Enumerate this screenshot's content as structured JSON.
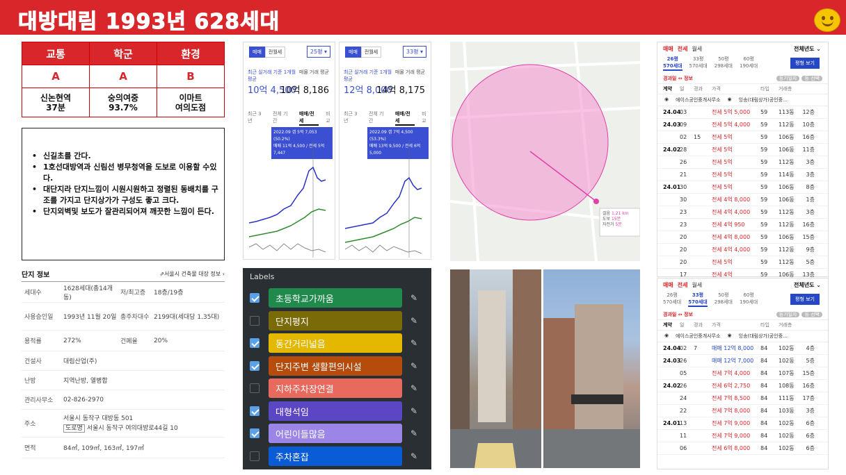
{
  "header": {
    "title": "대방대림 1993년 628세대"
  },
  "ratings": {
    "headers": [
      "교통",
      "학군",
      "환경"
    ],
    "grades": [
      "A",
      "A",
      "B"
    ],
    "details": [
      [
        "신논현역",
        "37분"
      ],
      [
        "숭의여중",
        "93.7%"
      ],
      [
        "이마트",
        "여의도점"
      ]
    ]
  },
  "notes": [
    "신길초를 간다.",
    "1호선대방역과 신림선 병무청역을 도보로 이용할 수있다.",
    "대단지라 단지느낌이 시원시원하고 정렬된 동배치를 구조를 가지고 단지상가가 구성도 좋고 크다.",
    "단지외벽및 보도가 잘관리되어져 깨끗한 느낌이 든다."
  ],
  "complex_info": {
    "title": "단지 정보",
    "link": "서울시 건축물 대장 정보",
    "rows": [
      {
        "k": "세대수",
        "v": "1628세대(총14개동)",
        "k2": "저/최고층",
        "v2": "18층/19층"
      },
      {
        "k": "사용승인일",
        "v": "1993년 11월 20일",
        "k2": "총주차대수",
        "v2": "2199대(세대당 1.35대)"
      },
      {
        "k": "용적률",
        "v": "272%",
        "k2": "건폐율",
        "v2": "20%"
      },
      {
        "k": "건설사",
        "v": "대림산업(주)",
        "k2": "",
        "v2": ""
      },
      {
        "k": "난방",
        "v": "지역난방, 열병합",
        "k2": "",
        "v2": ""
      },
      {
        "k": "관리사무소",
        "v": "02-826-2970",
        "k2": "",
        "v2": ""
      }
    ],
    "address_label": "주소",
    "address": "서울시 동작구 대방동 501",
    "road_tag": "도로명",
    "road_address": "서울시 동작구 여의대방로44길 10",
    "area_label": "면적",
    "area": "84㎡, 109㎡, 163㎡, 197㎡"
  },
  "charts": [
    {
      "tab1": "매매",
      "tab2": "전월세",
      "size": "25평",
      "label1": "최근 실거래 기준 1개월 평균",
      "value1": "10억 4,500",
      "label2": "매물 거래 평균",
      "value2": "10억 8,186",
      "periods": [
        "최근 3년",
        "전체 기간",
        "매매/전세",
        "비교"
      ],
      "tip1": "2022.09 갭 5억 7,053 (50.2%)",
      "tip2": "매매 11억 4,500 / 전세 5억 7,447"
    },
    {
      "tab1": "매매",
      "tab2": "전월세",
      "size": "33평",
      "label1": "최근 실거래 기준 1개월 평균",
      "value1": "12억 8,000",
      "label2": "매물 거래 평균",
      "value2": "14억 8,175",
      "periods": [
        "최근 3년",
        "전체 기간",
        "매매/전세",
        "비교"
      ],
      "tip1": "2022.09 갭 7억 4,500 (53.3%)",
      "tip2": "매매 13억 9,500 / 전세 6억 5,000"
    }
  ],
  "labels": {
    "title": "Labels",
    "items": [
      {
        "text": "초등학교가까움",
        "checked": true,
        "color": "#1f8a4c"
      },
      {
        "text": "단지평지",
        "checked": false,
        "color": "#7a6a08"
      },
      {
        "text": "동간거리넓음",
        "checked": true,
        "color": "#e5b800"
      },
      {
        "text": "단지주변 생활편의시설",
        "checked": true,
        "color": "#b54c0c"
      },
      {
        "text": "지하주차장연결",
        "checked": false,
        "color": "#e8695e"
      },
      {
        "text": "대형석임",
        "checked": true,
        "color": "#5b47c4"
      },
      {
        "text": "어린이들많음",
        "checked": true,
        "color": "#9b86e8"
      },
      {
        "text": "주차혼잡",
        "checked": false,
        "color": "#0a5bd6"
      }
    ]
  },
  "map": {
    "legend": [
      "걸음",
      "도보",
      "자전거"
    ],
    "legend_vals": [
      "1.21 km",
      "15분",
      "5분"
    ]
  },
  "tx1": {
    "tabs": [
      "매매",
      "전세",
      "월세"
    ],
    "year": "전체년도",
    "sizes": [
      [
        "26평",
        "570세대"
      ],
      [
        "33평",
        "570세대"
      ],
      [
        "50평",
        "298세대"
      ],
      [
        "60평",
        "190세대"
      ]
    ],
    "active_size": 0,
    "button": "평형 보기",
    "sub_left": "경과일 ↔ 정보",
    "sub_right": [
      "등기일자",
      "등 선택"
    ],
    "head": [
      "계약",
      "일",
      "경과",
      "가격",
      "타입",
      "거래층"
    ],
    "agents": [
      "에이스공인중개사무소",
      "잉송(대림상가)공인중…"
    ],
    "rows": [
      [
        "24.04",
        "03",
        "",
        "전세 5억 5,000",
        "59",
        "113동",
        "12층"
      ],
      [
        "24.03",
        "09",
        "",
        "전세 5억 4,000",
        "59",
        "112동",
        "10층"
      ],
      [
        "",
        "02",
        "15",
        "전세 5억",
        "59",
        "106동",
        "16층"
      ],
      [
        "24.02",
        "28",
        "",
        "전세 5억",
        "59",
        "106동",
        "11층"
      ],
      [
        "",
        "26",
        "",
        "전세 5억",
        "59",
        "112동",
        "3층"
      ],
      [
        "",
        "21",
        "",
        "전세 5억",
        "59",
        "114동",
        "3층"
      ],
      [
        "24.01",
        "30",
        "",
        "전세 5억",
        "59",
        "106동",
        "8층"
      ],
      [
        "",
        "30",
        "",
        "전세 4억 8,000",
        "59",
        "106동",
        "1층"
      ],
      [
        "",
        "23",
        "",
        "전세 4억 4,000",
        "59",
        "112동",
        "3층"
      ],
      [
        "",
        "23",
        "",
        "전세 4억 950",
        "59",
        "112동",
        "16층"
      ],
      [
        "",
        "20",
        "",
        "전세 4억 8,000",
        "59",
        "106동",
        "15층"
      ],
      [
        "",
        "20",
        "",
        "전세 4억 4,000",
        "59",
        "112동",
        "9층"
      ],
      [
        "",
        "20",
        "",
        "전세 5억",
        "59",
        "112동",
        "5층"
      ],
      [
        "",
        "17",
        "",
        "전세 4억",
        "59",
        "106동",
        "13층"
      ],
      [
        "",
        "16",
        "",
        "전세 4억 1,800",
        "59",
        "114동",
        "19층"
      ]
    ]
  },
  "tx2": {
    "tabs": [
      "매매",
      "전세",
      "월세"
    ],
    "year": "전체년도",
    "sizes": [
      [
        "26평",
        "570세대"
      ],
      [
        "33평",
        "570세대"
      ],
      [
        "50평",
        "298세대"
      ],
      [
        "60평",
        "190세대"
      ]
    ],
    "active_size": 1,
    "button": "평형 보기",
    "sub_left": "경과일 ↔ 정보",
    "sub_right": [
      "등기일자",
      "등 선택"
    ],
    "head": [
      "계약",
      "일",
      "경과",
      "가격",
      "타입",
      "거래층"
    ],
    "agents": [
      "에이스공인중개사무소",
      "잉송(대림상가)공인중…"
    ],
    "rows": [
      [
        "24.04",
        "02",
        "7",
        "매매 12억 8,000",
        "84",
        "102동",
        "4층"
      ],
      [
        "24.03",
        "26",
        "",
        "매매 12억 7,000",
        "84",
        "102동",
        "5층"
      ],
      [
        "",
        "05",
        "",
        "전세 7억 4,000",
        "84",
        "107동",
        "15층"
      ],
      [
        "24.02",
        "26",
        "",
        "전세 6억 2,750",
        "84",
        "108동",
        "16층"
      ],
      [
        "",
        "24",
        "",
        "전세 7억 8,500",
        "84",
        "111동",
        "17층"
      ],
      [
        "",
        "22",
        "",
        "전세 7억 8,000",
        "84",
        "103동",
        "3층"
      ],
      [
        "24.01",
        "13",
        "",
        "전세 7억 9,000",
        "84",
        "102동",
        "6층"
      ],
      [
        "",
        "11",
        "",
        "전세 7억 9,000",
        "84",
        "102동",
        "6층"
      ],
      [
        "",
        "06",
        "",
        "전세 6억 8,000",
        "84",
        "102동",
        "6층"
      ]
    ]
  }
}
